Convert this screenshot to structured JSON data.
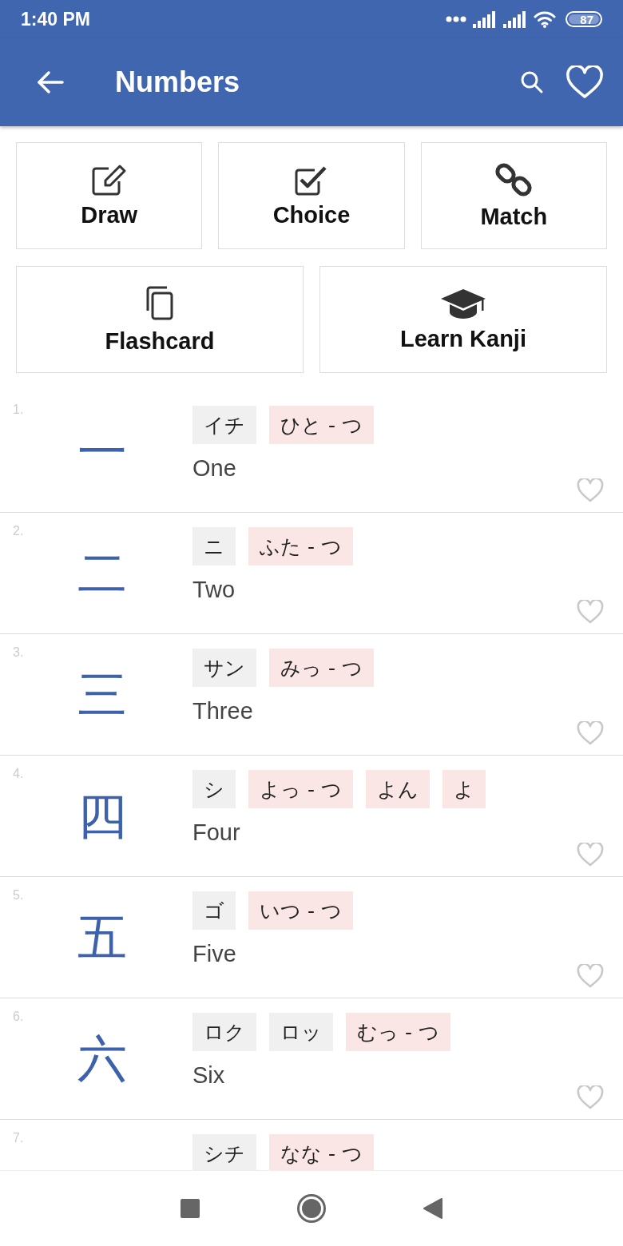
{
  "status_bar": {
    "time": "1:40 PM",
    "battery": "87"
  },
  "app_bar": {
    "title": "Numbers"
  },
  "modes": [
    {
      "label": "Draw"
    },
    {
      "label": "Choice"
    },
    {
      "label": "Match"
    },
    {
      "label": "Flashcard"
    },
    {
      "label": "Learn Kanji"
    }
  ],
  "kanji": [
    {
      "index": "1.",
      "kanji": "一",
      "readings": [
        {
          "text": "イチ",
          "kind": "on"
        },
        {
          "text": "ひと - つ",
          "kind": "kun"
        }
      ],
      "meaning": "One",
      "favorite": false
    },
    {
      "index": "2.",
      "kanji": "二",
      "readings": [
        {
          "text": "ニ",
          "kind": "on"
        },
        {
          "text": "ふた - つ",
          "kind": "kun"
        }
      ],
      "meaning": "Two",
      "favorite": false
    },
    {
      "index": "3.",
      "kanji": "三",
      "readings": [
        {
          "text": "サン",
          "kind": "on"
        },
        {
          "text": "みっ - つ",
          "kind": "kun"
        }
      ],
      "meaning": "Three",
      "favorite": false
    },
    {
      "index": "4.",
      "kanji": "四",
      "readings": [
        {
          "text": "シ",
          "kind": "on"
        },
        {
          "text": "よっ - つ",
          "kind": "kun"
        },
        {
          "text": "よん",
          "kind": "kun"
        },
        {
          "text": "よ",
          "kind": "kun"
        }
      ],
      "meaning": "Four",
      "favorite": false
    },
    {
      "index": "5.",
      "kanji": "五",
      "readings": [
        {
          "text": "ゴ",
          "kind": "on"
        },
        {
          "text": "いつ - つ",
          "kind": "kun"
        }
      ],
      "meaning": "Five",
      "favorite": false
    },
    {
      "index": "6.",
      "kanji": "六",
      "readings": [
        {
          "text": "ロク",
          "kind": "on"
        },
        {
          "text": "ロッ",
          "kind": "on"
        },
        {
          "text": "むっ - つ",
          "kind": "kun"
        }
      ],
      "meaning": "Six",
      "favorite": false
    },
    {
      "index": "7.",
      "readings": [
        {
          "text": "シチ",
          "kind": "on"
        },
        {
          "text": "なな - つ",
          "kind": "kun"
        }
      ]
    }
  ]
}
